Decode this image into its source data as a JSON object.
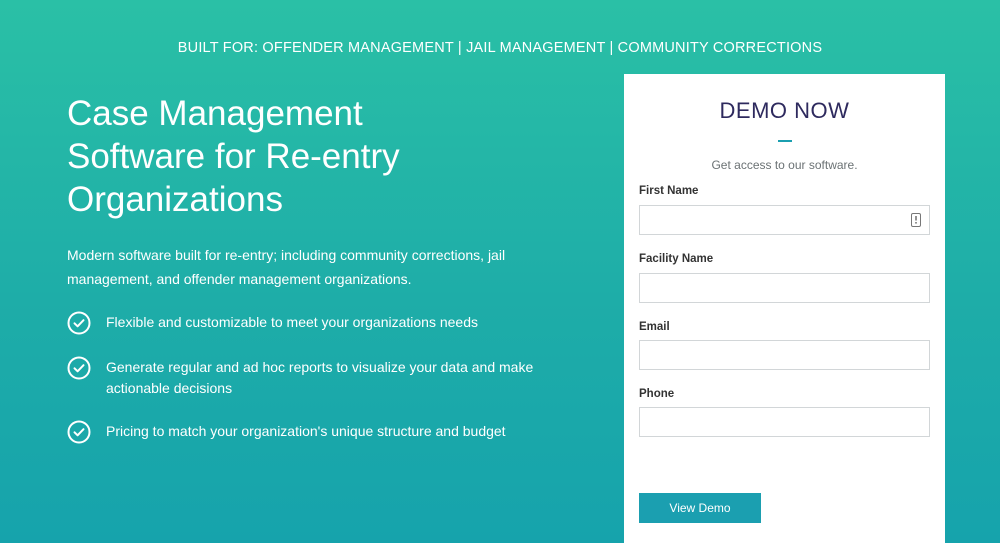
{
  "topline": "BUILT FOR: OFFENDER MANAGEMENT | JAIL MANAGEMENT | COMMUNITY CORRECTIONS",
  "hero": {
    "title": "Case Management Software for Re-entry Organizations",
    "lead": "Modern software built for re-entry; including community corrections, jail management, and offender management organizations.",
    "features": [
      "Flexible and customizable to meet your organizations needs",
      "Generate regular and ad hoc reports to visualize your data and make actionable decisions",
      "Pricing to match your organization's unique structure and budget"
    ]
  },
  "form": {
    "title": "DEMO NOW",
    "subtitle": "Get access to our software.",
    "fields": [
      {
        "label": "First Name",
        "value": ""
      },
      {
        "label": "Facility Name",
        "value": ""
      },
      {
        "label": "Email",
        "value": ""
      },
      {
        "label": "Phone",
        "value": ""
      }
    ],
    "submit_label": "View Demo"
  },
  "icons": {
    "feature": "check-circle-icon",
    "autofill": "keyboard-autofill-icon"
  },
  "colors": {
    "bg_top": "#2ac0a6",
    "bg_bottom": "#16a3ac",
    "accent": "#1b9fb0",
    "title": "#2e2a5e"
  }
}
